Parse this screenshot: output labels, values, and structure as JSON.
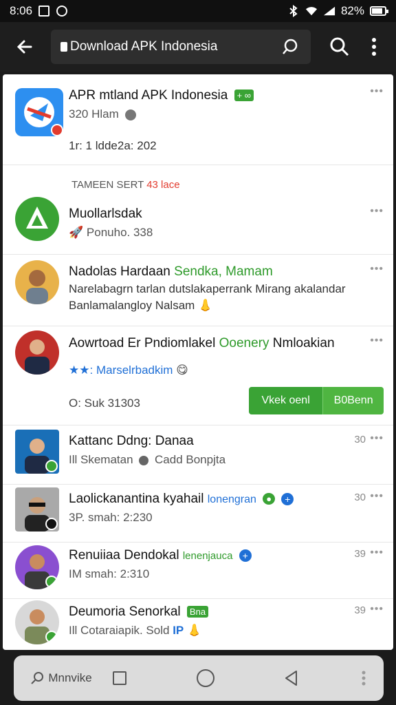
{
  "status": {
    "time": "8:06",
    "battery_text": "82%",
    "battery_level": 0.82
  },
  "toolbar": {
    "url": "Download APK Indonesia"
  },
  "top_card": {
    "title": "APR mtland APK Indonesia",
    "title_tag": "+ ∞",
    "subtitle": "320 Hlam",
    "meta": "1r: 1 ldde2a: 202"
  },
  "section": {
    "label": "TAMEEN SERT",
    "label_highlight": "43 lace"
  },
  "rows": [
    {
      "title": "Muollarlsdak",
      "sub": "Ponuho. 338"
    },
    {
      "title": "Nadolas Hardaan",
      "title_accent": "Sendka, Mamam",
      "line2": "Narelabagrn tarlan dutslakaperrank Mirang akalandar",
      "line3": "Banlamalangloy Nalsam"
    },
    {
      "title": "Aowrtoad Er Pndiomlakel",
      "title_accent": "Ooenery",
      "title_tail": "Nmloakian",
      "stars": "★★:",
      "sub_accent": "Marselrbadkim",
      "meta": "O: Suk 31303",
      "btn_a": "Vkek oenl",
      "btn_b": "B0Benn"
    },
    {
      "title": "Kattanc Ddng: Danaa",
      "sub": "Ill Skematan",
      "sub_tail": "Cadd Bonpjta",
      "time": "30"
    },
    {
      "title": "Laolickanantina kyahail",
      "title_accent": "lonengran",
      "sub": "3P. smah: 2:230",
      "time": "30"
    },
    {
      "title": "Renuiiaa Dendokal",
      "title_accent": "lenenjauca",
      "sub": "IM smah: 2:310",
      "time": "39"
    },
    {
      "title": "Deumoria Senorkal",
      "title_accent": "Bna",
      "sub": "Ill Cotaraiapik. Sold",
      "sub_accent": "IP",
      "time": "39"
    }
  ],
  "navbar": {
    "label": "Mnnvike"
  },
  "colors": {
    "accent_green": "#3aa335",
    "accent_red": "#e23b2e",
    "accent_blue": "#1f6fd6"
  }
}
